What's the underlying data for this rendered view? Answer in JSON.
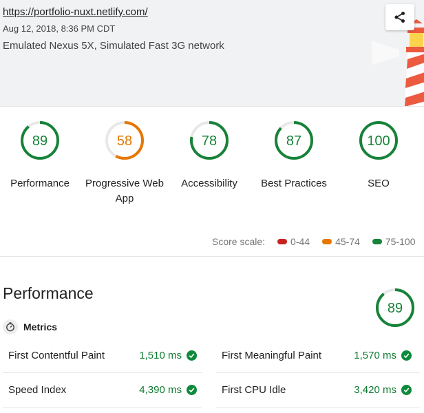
{
  "header": {
    "url": "https://portfolio-nuxt.netlify.com/",
    "date": "Aug 12, 2018, 8:36 PM CDT",
    "environment": "Emulated Nexus 5X, Simulated Fast 3G network",
    "share_icon": "share-icon"
  },
  "colors": {
    "pass": "#178239",
    "average": "#e67700",
    "fail": "#c7221f",
    "track": "#e8e8e8"
  },
  "categories": [
    {
      "label": "Performance",
      "score": "89",
      "score_value": 89,
      "status": "pass"
    },
    {
      "label": "Progressive Web App",
      "score": "58",
      "score_value": 58,
      "status": "average"
    },
    {
      "label": "Accessibility",
      "score": "78",
      "score_value": 78,
      "status": "pass"
    },
    {
      "label": "Best Practices",
      "score": "87",
      "score_value": 87,
      "status": "pass"
    },
    {
      "label": "SEO",
      "score": "100",
      "score_value": 100,
      "status": "pass"
    }
  ],
  "score_scale": {
    "label": "Score scale:",
    "ranges": [
      {
        "label": "0-44",
        "status": "fail"
      },
      {
        "label": "45-74",
        "status": "average"
      },
      {
        "label": "75-100",
        "status": "pass"
      }
    ]
  },
  "performance": {
    "title": "Performance",
    "score": "89",
    "score_value": 89,
    "metrics_label": "Metrics",
    "metrics_icon": "timer-icon",
    "metrics": [
      {
        "name": "First Contentful Paint",
        "value": "1,510 ms",
        "status": "pass"
      },
      {
        "name": "First Meaningful Paint",
        "value": "1,570 ms",
        "status": "pass"
      },
      {
        "name": "Speed Index",
        "value": "4,390 ms",
        "status": "pass"
      },
      {
        "name": "First CPU Idle",
        "value": "3,420 ms",
        "status": "pass"
      }
    ]
  }
}
